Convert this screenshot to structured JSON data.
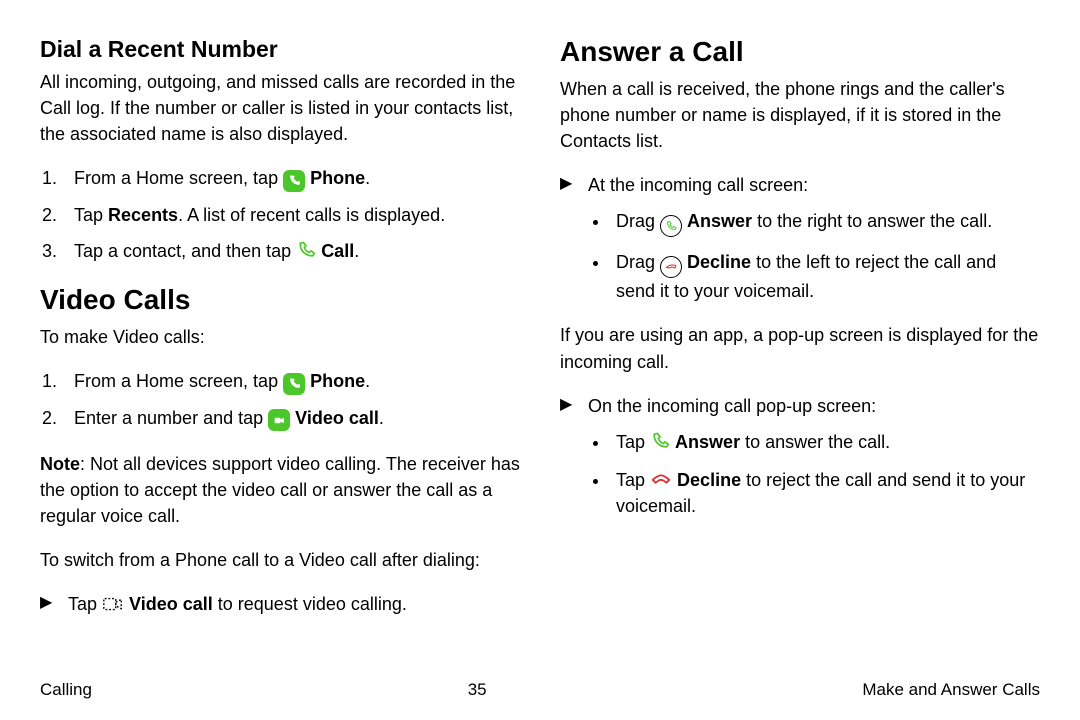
{
  "left": {
    "dial_heading": "Dial a Recent Number",
    "dial_intro": "All incoming, outgoing, and missed calls are recorded in the Call log. If the number or caller is listed in your contacts list, the associated name is also displayed.",
    "dial_steps": {
      "s1_pre": "From a Home screen, tap ",
      "s1_bold": "Phone",
      "s1_end": ".",
      "s2_pre": "Tap ",
      "s2_bold": "Recents",
      "s2_end": ". A list of recent calls is displayed.",
      "s3_pre": "Tap a contact, and then tap ",
      "s3_bold": "Call",
      "s3_end": "."
    },
    "video_heading": "Video Calls",
    "video_intro": "To make Video calls:",
    "video_steps": {
      "s1_pre": "From a Home screen, tap ",
      "s1_bold": "Phone",
      "s1_end": ".",
      "s2_pre": "Enter a number and tap ",
      "s2_bold": "Video call",
      "s2_end": "."
    },
    "video_note_pre": "Note",
    "video_note_rest": ": Not all devices support video calling. The receiver has the option to accept the video call or answer the call as a regular voice call.",
    "video_switch": "To switch from a Phone call to a Video call after dialing:",
    "video_switch_item_pre": "Tap ",
    "video_switch_item_bold": "Video call",
    "video_switch_item_end": " to request video calling."
  },
  "right": {
    "answer_heading": "Answer a Call",
    "answer_intro": "When a call is received, the phone rings and the caller's phone number or name is displayed, if it is stored in the Contacts list.",
    "incoming_item": "At the incoming call screen:",
    "incoming_sub1_pre": "Drag ",
    "incoming_sub1_bold": "Answer",
    "incoming_sub1_end": " to the right to answer the call.",
    "incoming_sub2_pre": "Drag ",
    "incoming_sub2_bold": "Decline",
    "incoming_sub2_end": " to the left to reject the call and send it to your voicemail.",
    "popup_intro": "If you are using an app, a pop-up screen is displayed for the incoming call.",
    "popup_item": "On the incoming call pop-up screen:",
    "popup_sub1_pre": "Tap ",
    "popup_sub1_bold": "Answer",
    "popup_sub1_end": " to answer the call.",
    "popup_sub2_pre": "Tap ",
    "popup_sub2_bold": "Decline",
    "popup_sub2_end": " to reject the call and send it to your voicemail."
  },
  "footer": {
    "left": "Calling",
    "center": "35",
    "right": "Make and Answer Calls"
  }
}
